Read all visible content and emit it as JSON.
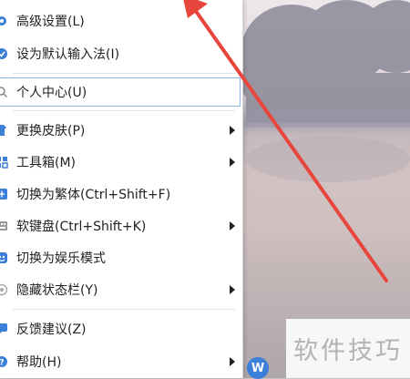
{
  "menu": {
    "items": [
      {
        "label": "高级设置(L)",
        "icon": "gear-icon",
        "submenu": false
      },
      {
        "label": "设为默认输入法(I)",
        "icon": "check-circle-icon",
        "submenu": false
      },
      {
        "label": "个人中心(U)",
        "icon": "search-icon",
        "submenu": false
      },
      {
        "label": "更换皮肤(P)",
        "icon": "shirt-icon",
        "submenu": true
      },
      {
        "label": "工具箱(M)",
        "icon": "toolbox-icon",
        "submenu": true
      },
      {
        "label": "切换为繁体(Ctrl+Shift+F)",
        "icon": "traditional-chinese-icon",
        "submenu": false
      },
      {
        "label": "软键盘(Ctrl+Shift+K)",
        "icon": "keyboard-icon",
        "submenu": true
      },
      {
        "label": "切换为娱乐模式",
        "icon": "entertainment-icon",
        "submenu": false
      },
      {
        "label": "隐藏状态栏(Y)",
        "icon": "statusbar-icon",
        "submenu": true
      },
      {
        "label": "反馈建议(Z)",
        "icon": "feedback-icon",
        "submenu": false
      },
      {
        "label": "帮助(H)",
        "icon": "help-icon",
        "submenu": true
      }
    ]
  },
  "watermark": {
    "text": "软件技巧"
  },
  "colors": {
    "accent": "#3b7fd8",
    "arrow": "#e8453c",
    "highlight_border": "#8fb4e8"
  }
}
